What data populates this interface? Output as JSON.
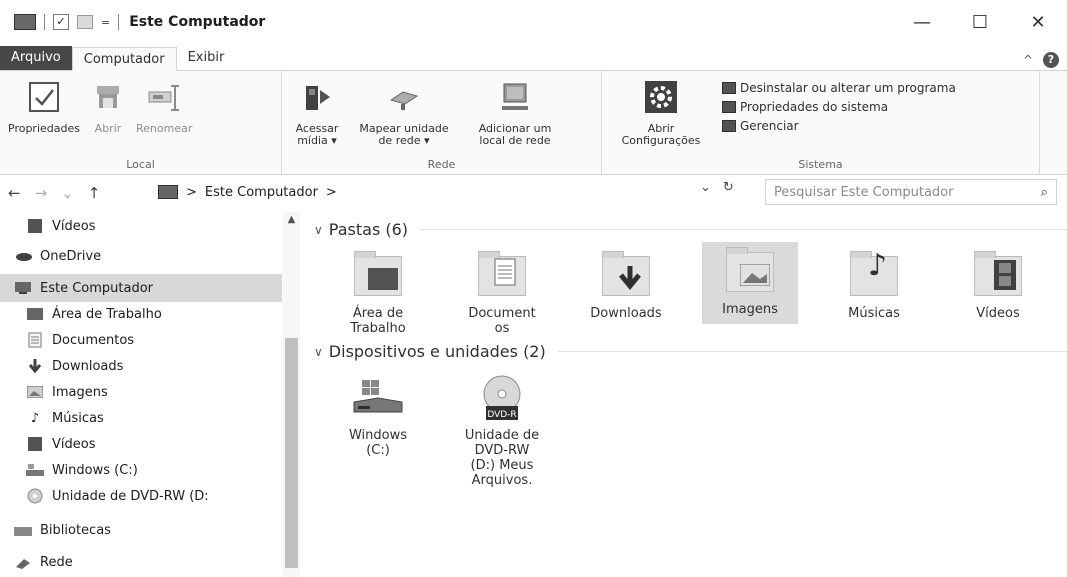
{
  "window": {
    "title": "Este Computador",
    "min": "—",
    "max": "☐",
    "close": "✕"
  },
  "quick_access": {
    "dropdown": "="
  },
  "tabs": [
    "Arquivo",
    "Computador",
    "Exibir"
  ],
  "ribbon_controls": {
    "collapse": "^",
    "help": "?"
  },
  "ribbon": {
    "local": {
      "name": "Local",
      "buttons": [
        "Propriedades",
        "Abrir",
        "Renomear"
      ]
    },
    "rede": {
      "name": "Rede",
      "buttons": [
        {
          "line1": "Acessar",
          "line2": "mídia ▾"
        },
        {
          "line1": "Mapear unidade",
          "line2": "de rede ▾"
        },
        {
          "line1": "Adicionar um",
          "line2": "local de rede"
        }
      ]
    },
    "sistema": {
      "name": "Sistema",
      "open_line1": "Abrir",
      "open_line2": "Configurações",
      "items": [
        "Desinstalar ou alterar um programa",
        "Propriedades do sistema",
        "Gerenciar"
      ]
    }
  },
  "address": {
    "back": "←",
    "forward": "→",
    "recent": "⌄",
    "up": "↑",
    "path": [
      "Este Computador"
    ],
    "sep": ">",
    "dropdown": "⌄",
    "refresh": "↻",
    "search_placeholder": "Pesquisar Este Computador",
    "search_icon": "⌕"
  },
  "sidebar": {
    "items": [
      {
        "label": "Vídeos",
        "icon": "video-icon"
      },
      {
        "label": "OneDrive",
        "icon": "onedrive-icon"
      },
      {
        "label": "Este Computador",
        "icon": "computer-icon"
      },
      {
        "label": "Área de Trabalho",
        "icon": "desktop-icon"
      },
      {
        "label": "Documentos",
        "icon": "document-icon"
      },
      {
        "label": "Downloads",
        "icon": "download-icon"
      },
      {
        "label": "Imagens",
        "icon": "image-icon"
      },
      {
        "label": "Músicas",
        "icon": "music-icon"
      },
      {
        "label": "Vídeos",
        "icon": "video-icon"
      },
      {
        "label": "Windows (C:)",
        "icon": "drive-icon"
      },
      {
        "label": "Unidade de DVD-RW (D:",
        "icon": "dvd-icon"
      },
      {
        "label": "Bibliotecas",
        "icon": "library-icon"
      },
      {
        "label": "Rede",
        "icon": "network-icon"
      }
    ]
  },
  "content": {
    "folders_header": "Pastas (6)",
    "folders": [
      {
        "line1": "Área de",
        "line2": "Trabalho"
      },
      {
        "line1": "Document",
        "line2": "os"
      },
      {
        "line1": "Downloads",
        "line2": ""
      },
      {
        "line1": "Imagens",
        "line2": ""
      },
      {
        "line1": "Músicas",
        "line2": ""
      },
      {
        "line1": "Vídeos",
        "line2": ""
      }
    ],
    "devices_header": "Dispositivos e unidades (2)",
    "devices": [
      {
        "line1": "Windows",
        "line2": "(C:)",
        "line3": "",
        "line4": ""
      },
      {
        "line1": "Unidade de",
        "line2": "DVD-RW",
        "line3": "(D:) Meus",
        "line4": "Arquivos.",
        "disc_label": "DVD-R"
      }
    ]
  }
}
